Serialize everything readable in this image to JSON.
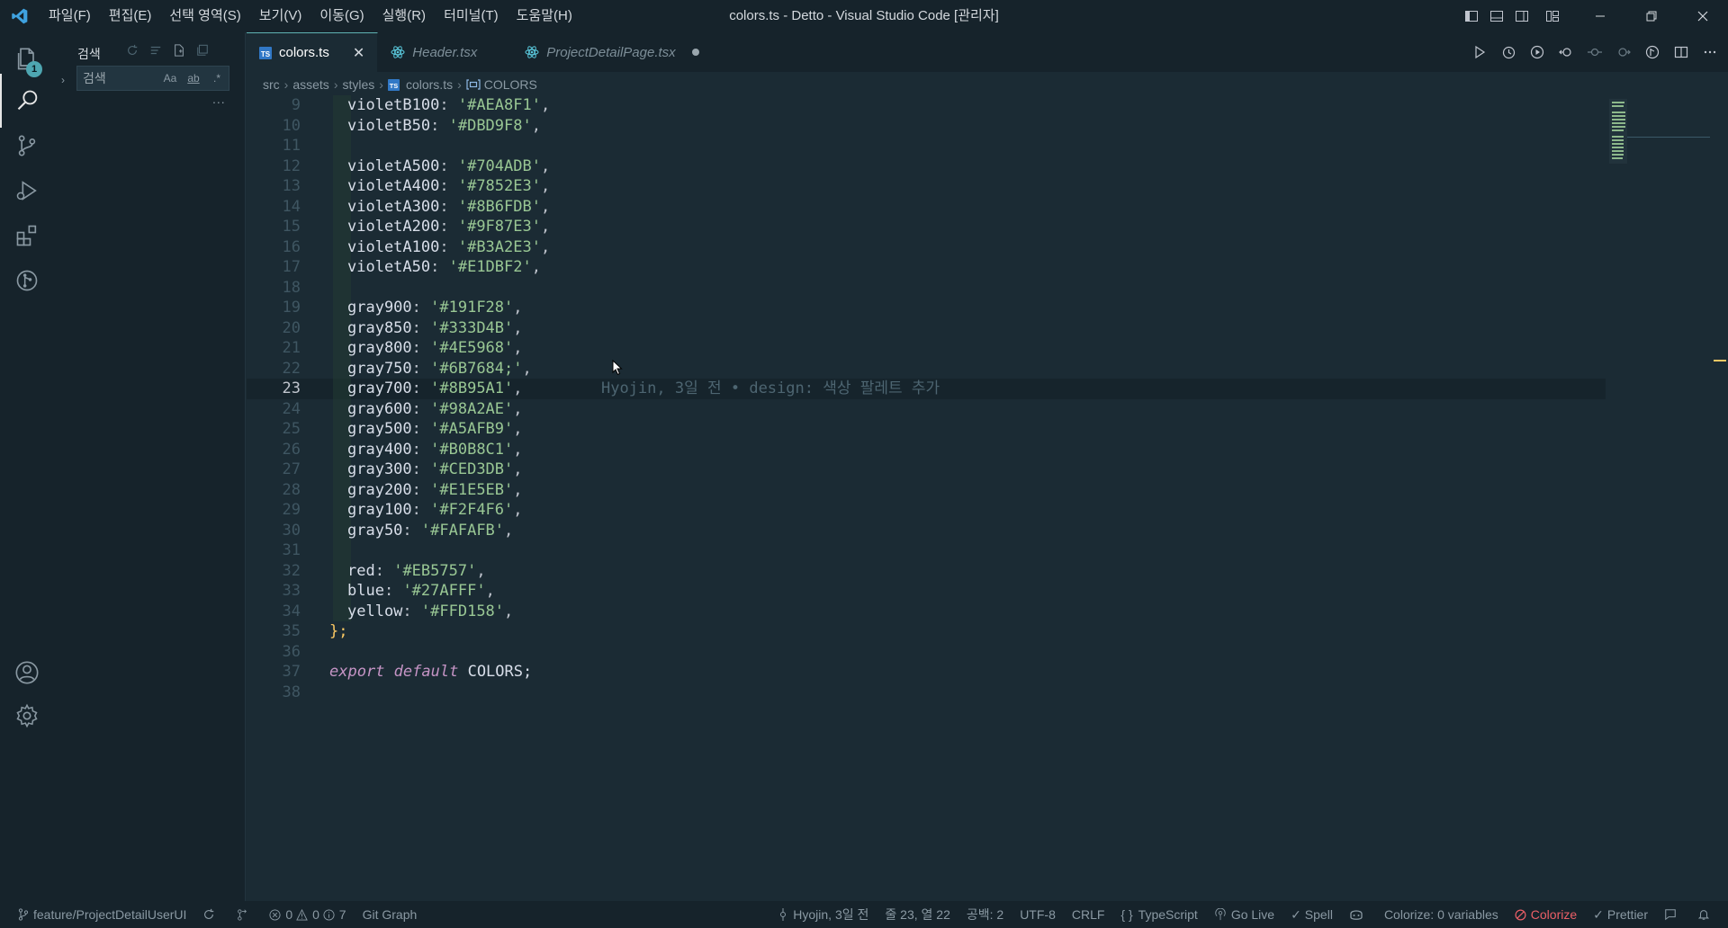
{
  "titlebar": {
    "title": "colors.ts - Detto - Visual Studio Code [관리자]",
    "menus": [
      "파일(F)",
      "편집(E)",
      "선택 영역(S)",
      "보기(V)",
      "이동(G)",
      "실행(R)",
      "터미널(T)",
      "도움말(H)"
    ]
  },
  "activity": {
    "explorer_badge": "1",
    "items": [
      "files-icon",
      "search-icon",
      "source-control-icon",
      "run-debug-icon",
      "extensions-icon",
      "git-graph-icon",
      "account-icon",
      "settings-gear-icon"
    ]
  },
  "sidebar": {
    "title": "검색",
    "search_placeholder": "검색",
    "opt_case": "Aa",
    "opt_word": "ab",
    "opt_regex": ".*",
    "more": "..."
  },
  "tabs": [
    {
      "label": "colors.ts",
      "active": true,
      "icon": "ts-file-icon"
    },
    {
      "label": "Header.tsx",
      "active": false,
      "icon": "react-icon"
    },
    {
      "label": "ProjectDetailPage.tsx",
      "active": false,
      "icon": "react-icon",
      "modified": true
    }
  ],
  "breadcrumb": [
    "src",
    "assets",
    "styles",
    "colors.ts",
    "COLORS"
  ],
  "editor": {
    "current_line": 23,
    "blame": "Hyojin, 3일 전 • design: 색상 팔레트 추가",
    "lines": [
      {
        "n": "9",
        "key": "violetB100",
        "val": "'#AEA8F1'",
        "end": ","
      },
      {
        "n": "10",
        "key": "violetB50",
        "val": "'#DBD9F8'",
        "end": ","
      },
      {
        "n": "11",
        "key": "",
        "val": "",
        "end": ""
      },
      {
        "n": "12",
        "key": "violetA500",
        "val": "'#704ADB'",
        "end": ","
      },
      {
        "n": "13",
        "key": "violetA400",
        "val": "'#7852E3'",
        "end": ","
      },
      {
        "n": "14",
        "key": "violetA300",
        "val": "'#8B6FDB'",
        "end": ","
      },
      {
        "n": "15",
        "key": "violetA200",
        "val": "'#9F87E3'",
        "end": ","
      },
      {
        "n": "16",
        "key": "violetA100",
        "val": "'#B3A2E3'",
        "end": ","
      },
      {
        "n": "17",
        "key": "violetA50",
        "val": "'#E1DBF2'",
        "end": ","
      },
      {
        "n": "18",
        "key": "",
        "val": "",
        "end": ""
      },
      {
        "n": "19",
        "key": "gray900",
        "val": "'#191F28'",
        "end": ","
      },
      {
        "n": "20",
        "key": "gray850",
        "val": "'#333D4B'",
        "end": ","
      },
      {
        "n": "21",
        "key": "gray800",
        "val": "'#4E5968'",
        "end": ","
      },
      {
        "n": "22",
        "key": "gray750",
        "val": "'#6B7684;'",
        "end": ","
      },
      {
        "n": "23",
        "key": "gray700",
        "val": "'#8B95A1'",
        "end": ","
      },
      {
        "n": "24",
        "key": "gray600",
        "val": "'#98A2AE'",
        "end": ","
      },
      {
        "n": "25",
        "key": "gray500",
        "val": "'#A5AFB9'",
        "end": ","
      },
      {
        "n": "26",
        "key": "gray400",
        "val": "'#B0B8C1'",
        "end": ","
      },
      {
        "n": "27",
        "key": "gray300",
        "val": "'#CED3DB'",
        "end": ","
      },
      {
        "n": "28",
        "key": "gray200",
        "val": "'#E1E5EB'",
        "end": ","
      },
      {
        "n": "29",
        "key": "gray100",
        "val": "'#F2F4F6'",
        "end": ","
      },
      {
        "n": "30",
        "key": "gray50",
        "val": "'#FAFAFB'",
        "end": ","
      },
      {
        "n": "31",
        "key": "",
        "val": "",
        "end": ""
      },
      {
        "n": "32",
        "key": "red",
        "val": "'#EB5757'",
        "end": ","
      },
      {
        "n": "33",
        "key": "blue",
        "val": "'#27AFFF'",
        "end": ","
      },
      {
        "n": "34",
        "key": "yellow",
        "val": "'#FFD158'",
        "end": ","
      }
    ],
    "closing": "};",
    "closing_n": "35",
    "blank36": "36",
    "export_n": "37",
    "export_kw1": "export",
    "export_kw2": "default",
    "export_name": "COLORS;",
    "blank38": "38"
  },
  "statusbar": {
    "branch": "feature/ProjectDetailUserUI",
    "errors": "0",
    "warnings": "0",
    "infos": "7",
    "git_graph": "Git Graph",
    "blame": "Hyojin, 3일 전",
    "position": "줄 23, 열 22",
    "spaces": "공백: 2",
    "encoding": "UTF-8",
    "eol": "CRLF",
    "language": "TypeScript",
    "golive": "Go Live",
    "spell": "Spell",
    "colorize_vars": "Colorize: 0 variables",
    "colorize": "Colorize",
    "prettier": "Prettier"
  },
  "colors": {
    "accent": "#5fb3b3",
    "string": "#99c794",
    "keyword": "#c594c5",
    "bracket": "#fac863",
    "error": "#ec5f67",
    "badge": "#4ea6b1"
  }
}
